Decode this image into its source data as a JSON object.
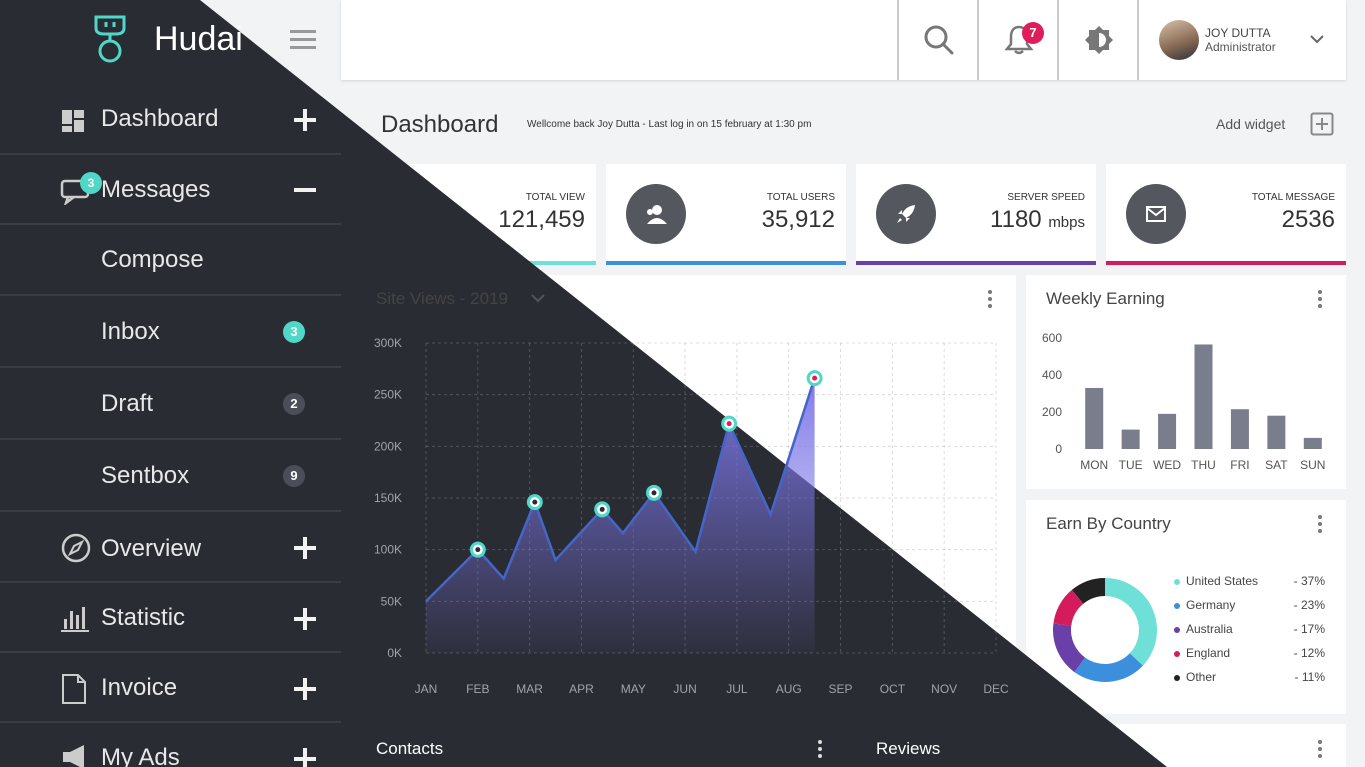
{
  "brand": {
    "title": "Hudai"
  },
  "sidebar": {
    "items": [
      {
        "label": "Dashboard",
        "toggle": "+"
      },
      {
        "label": "Messages",
        "toggle": "−",
        "badge": "3"
      },
      {
        "label": "Compose"
      },
      {
        "label": "Inbox",
        "count": "3"
      },
      {
        "label": "Draft",
        "count": "2"
      },
      {
        "label": "Sentbox",
        "count": "9"
      },
      {
        "label": "Overview",
        "toggle": "+"
      },
      {
        "label": "Statistic",
        "toggle": "+"
      },
      {
        "label": "Invoice",
        "toggle": "+"
      },
      {
        "label": "My Ads",
        "toggle": "+"
      }
    ]
  },
  "topbar": {
    "notification_count": "7",
    "user": {
      "name": "JOY DUTTA",
      "role": "Administrator"
    }
  },
  "page": {
    "title": "Dashboard",
    "welcome": "Wellcome back Joy Dutta - Last log in on 15 february at 1:30 pm",
    "add_widget": "Add widget"
  },
  "stats": [
    {
      "label": "TOTAL VIEW",
      "value": "121,459",
      "unit": "",
      "color": "#6ee0d7",
      "icon": "eye-icon"
    },
    {
      "label": "TOTAL USERS",
      "value": "35,912",
      "unit": "",
      "color": "#3c8fdc",
      "icon": "users-icon"
    },
    {
      "label": "SERVER SPEED",
      "value": "1180",
      "unit": "mbps",
      "color": "#6a3fa8",
      "icon": "rocket-icon"
    },
    {
      "label": "TOTAL MESSAGE",
      "value": "2536",
      "unit": "",
      "color": "#d41c5c",
      "icon": "envelope-icon"
    }
  ],
  "panels": {
    "site_views": "Site Views - 2019",
    "weekly_earning": "Weekly Earning",
    "earn_by_country": "Earn By Country",
    "contacts": "Contacts",
    "reviews": "Reviews"
  },
  "chart_data": [
    {
      "type": "area",
      "title": "Site Views - 2019",
      "categories": [
        "JAN",
        "FEB",
        "MAR",
        "APR",
        "MAY",
        "JUN",
        "JUL",
        "AUG",
        "SEP",
        "OCT",
        "NOV",
        "DEC"
      ],
      "y_tick_labels": [
        "0K",
        "50K",
        "100K",
        "150K",
        "200K",
        "250K",
        "300K"
      ],
      "ylim": [
        0,
        300000
      ],
      "x": [
        0,
        1,
        1.5,
        2.1,
        2.5,
        3.4,
        3.8,
        4.4,
        5.2,
        5.85,
        6.65,
        7.5
      ],
      "y": [
        50000,
        100000,
        72000,
        146000,
        90000,
        139000,
        116000,
        155000,
        98000,
        222000,
        134000,
        266000
      ],
      "highlighted_points": [
        1,
        3,
        5,
        7,
        9,
        11
      ],
      "grid": true
    },
    {
      "type": "bar",
      "title": "Weekly Earning",
      "categories": [
        "MON",
        "TUE",
        "WED",
        "THU",
        "FRI",
        "SAT",
        "SUN"
      ],
      "values": [
        330,
        105,
        190,
        565,
        215,
        180,
        60
      ],
      "y_tick_labels": [
        "0",
        "200",
        "400",
        "600"
      ],
      "ylim": [
        0,
        600
      ]
    },
    {
      "type": "pie",
      "title": "Earn By Country",
      "labels": [
        "United States",
        "Germany",
        "Australia",
        "England",
        "Other"
      ],
      "pct_labels": [
        "- 37%",
        "- 23%",
        "- 17%",
        "- 12%",
        "- 11%"
      ],
      "values": [
        37,
        23,
        17,
        12,
        11
      ],
      "colors": [
        "#6ee0d7",
        "#3c8fdc",
        "#6a3fa8",
        "#d41c5c",
        "#222222"
      ]
    }
  ]
}
